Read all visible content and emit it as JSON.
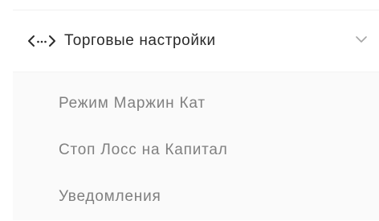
{
  "menu": {
    "header": {
      "icon": "code-icon",
      "title": "Торговые настройки",
      "expanded": true,
      "chevron_icon": "chevron-down-icon"
    },
    "items": [
      {
        "label": "Режим Маржин Кат"
      },
      {
        "label": "Стоп Лосс на Капитал"
      },
      {
        "label": "Уведомления"
      }
    ]
  },
  "colors": {
    "header_text": "#2b2b2b",
    "item_text": "#808080",
    "submenu_background": "#fafafa",
    "chevron": "#a6a6a6"
  }
}
